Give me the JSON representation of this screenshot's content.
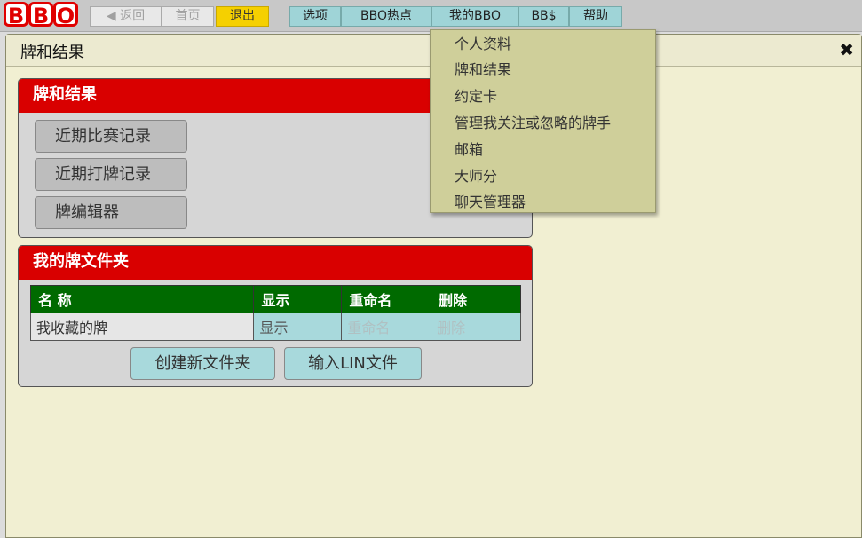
{
  "logo": {
    "letters": [
      "B",
      "B",
      "O"
    ]
  },
  "nav": {
    "back": "◀ 返回",
    "home": "首页",
    "logout": "退出"
  },
  "menu": {
    "options": "选项",
    "hot": "BBO热点",
    "mybbo": "我的BBO",
    "bbdollar": "BB$",
    "help": "帮助"
  },
  "window": {
    "title": "牌和结果",
    "close": "✖"
  },
  "results_panel": {
    "title": "牌和结果",
    "buttons": [
      "近期比赛记录",
      "近期打牌记录",
      "牌编辑器"
    ]
  },
  "folders_panel": {
    "title": "我的牌文件夹",
    "columns": [
      "名 称",
      "显示",
      "重命名",
      "删除"
    ],
    "rows": [
      {
        "name": "我收藏的牌",
        "show": "显示",
        "rename": "重命名",
        "delete": "删除"
      }
    ],
    "new_folder": "创建新文件夹",
    "import_lin": "输入LIN文件"
  },
  "dropdown": {
    "items": [
      "个人资料",
      "牌和结果",
      "约定卡",
      "管理我关注或忽略的牌手",
      "邮箱",
      "大师分",
      "聊天管理器"
    ]
  },
  "colors": {
    "panel_header": "#d90000",
    "table_header": "#006a00",
    "menu": "#9fd4d7",
    "window_bg": "#f1efd2",
    "dropdown_bg": "#cfcf9a",
    "logout": "#f5d000"
  }
}
